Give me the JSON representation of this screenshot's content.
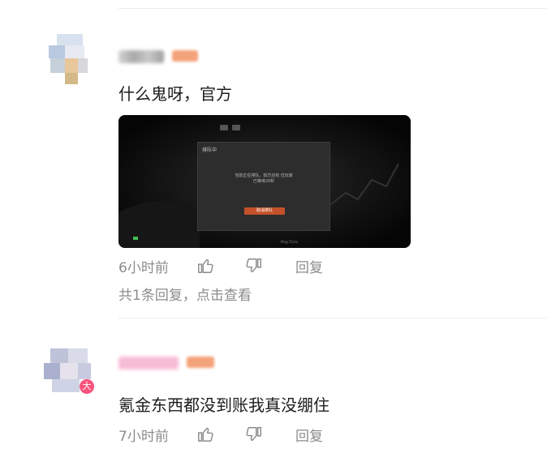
{
  "comments": [
    {
      "text": "什么鬼呀，官方",
      "time": "6小时前",
      "reply_label": "回复",
      "replies_summary": "共1条回复，点击查看",
      "image": {
        "dialog_title": "排队中",
        "message_line1": "当前正在排队，前方还有   位玩家",
        "message_line2": "已等待20秒",
        "button_label": "取消排队",
        "status_center": "Ping:71ms"
      }
    },
    {
      "text": "氪金东西都没到账我真没绷住",
      "time": "7小时前",
      "reply_label": "回复",
      "avatar_badge": "大"
    }
  ],
  "colors": {
    "meta_text": "#8c8c8c",
    "divider": "#ececec",
    "button_accent": "#c4512a",
    "badge_pink": "#f7537c",
    "level_orange": "#f4a27a"
  },
  "icons": [
    "thumb-up-icon",
    "thumb-down-icon"
  ]
}
